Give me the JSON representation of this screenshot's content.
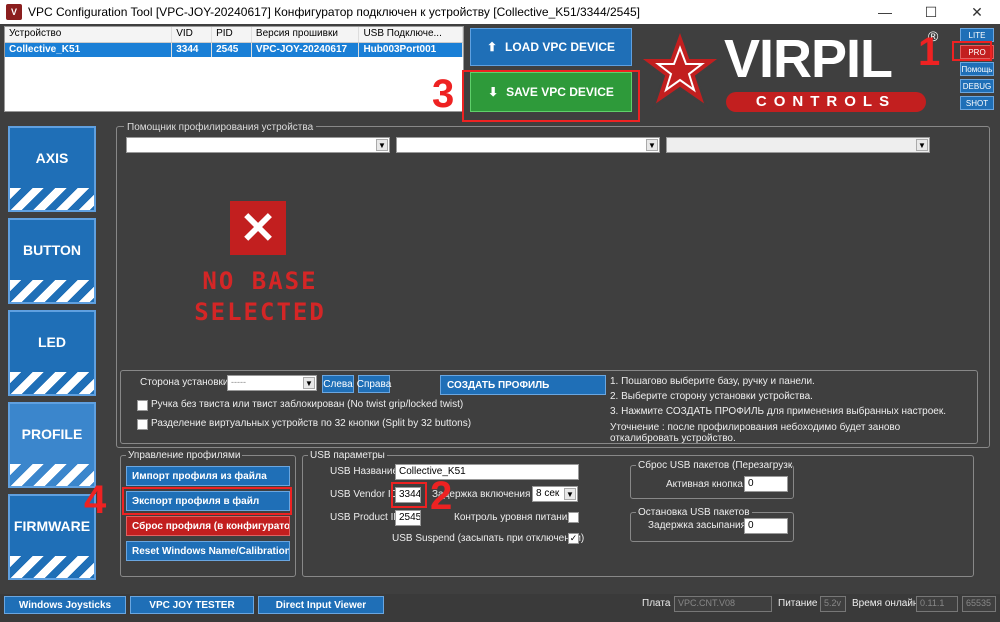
{
  "window": {
    "title": "VPC Configuration Tool [VPC-JOY-20240617] Конфигуратор подключен к устройству [Collective_K51/3344/2545]",
    "app_icon": "V",
    "minimize": "—",
    "maximize": "☐",
    "close": "✕"
  },
  "device_table": {
    "headers": [
      "Устройство",
      "VID",
      "PID",
      "Версия прошивки",
      "USB Подключе..."
    ],
    "rows": [
      [
        "Collective_K51",
        "3344",
        "2545",
        "VPC-JOY-20240617",
        "Hub003Port001"
      ]
    ]
  },
  "toolbar": {
    "load_label": "LOAD VPC DEVICE",
    "save_label": "SAVE VPC DEVICE"
  },
  "logo": {
    "text_main": "VIRPIL",
    "text_sub": "CONTROLS",
    "reg": "®"
  },
  "mode_tabs": [
    "LITE",
    "PRO",
    "Помощь",
    "DEBUG",
    "SHOT"
  ],
  "nav": [
    "AXIS",
    "BUTTON",
    "LED",
    "PROFILE",
    "FIRMWARE"
  ],
  "helper": {
    "legend": "Помощник профилирования устройства",
    "no_base_line1": "NO BASE",
    "no_base_line2": "SELECTED",
    "side_label": "Сторона установки",
    "side_value": "-----",
    "left_btn": "Слева",
    "right_btn": "Справа",
    "create_btn": "СОЗДАТЬ ПРОФИЛЬ",
    "chk1": "Ручка без твиста или твист заблокирован (No twist grip/locked twist)",
    "chk2": "Разделение виртуальных устройств по 32 кнопки (Split by 32 buttons)",
    "steps": [
      "1. Пошагово выберите базу, ручку и панели.",
      "2. Выберите сторону установки устройства.",
      "3. Нажмите СОЗДАТЬ ПРОФИЛЬ для применения выбранных настроек.",
      "Уточнение : после профилирования небоходимо будет заново откалибровать устройство."
    ]
  },
  "profile_mgmt": {
    "legend": "Управление профилями",
    "import": "Импорт профиля из файла",
    "export": "Экспорт профиля в файл",
    "reset": "Сброс профиля (в конфигуратор)",
    "reset_names": "Reset Windows Name/Calibration"
  },
  "usb": {
    "legend": "USB параметры",
    "name_label": "USB Название",
    "name_value": "Collective_K51",
    "vid_label": "USB Vendor ID",
    "vid_value": "3344",
    "pid_label": "USB Product ID",
    "pid_value": "2545",
    "delay_label": "Задержка включения",
    "delay_value": "8 сек",
    "power_label": "Контроль уровня питания",
    "suspend_label": "USB Suspend (засыпать при отключении)",
    "reset_group": "Сброс USB пакетов (Перезагрузка сес",
    "active_btn_label": "Активная кнопка",
    "active_btn_value": "0",
    "stop_group": "Остановка USB пакетов",
    "sleep_label": "Задержка засыпания",
    "sleep_value": "0"
  },
  "bottom": {
    "btn1": "Windows Joysticks",
    "btn2": "VPC JOY TESTER",
    "btn3": "Direct Input Viewer",
    "board_label": "Плата",
    "board_value": "VPC.CNT.V08",
    "power_label": "Питание",
    "power_value": "5.2v",
    "uptime_label": "Время онлайн",
    "uptime_value": "0.11.1",
    "extra_value": "65535"
  },
  "annotations": [
    "1",
    "2",
    "3",
    "4"
  ],
  "colors": {
    "accent_blue": "#1f6fb7",
    "save_green": "#2e9a3a",
    "annotation_red": "#ee2222"
  }
}
